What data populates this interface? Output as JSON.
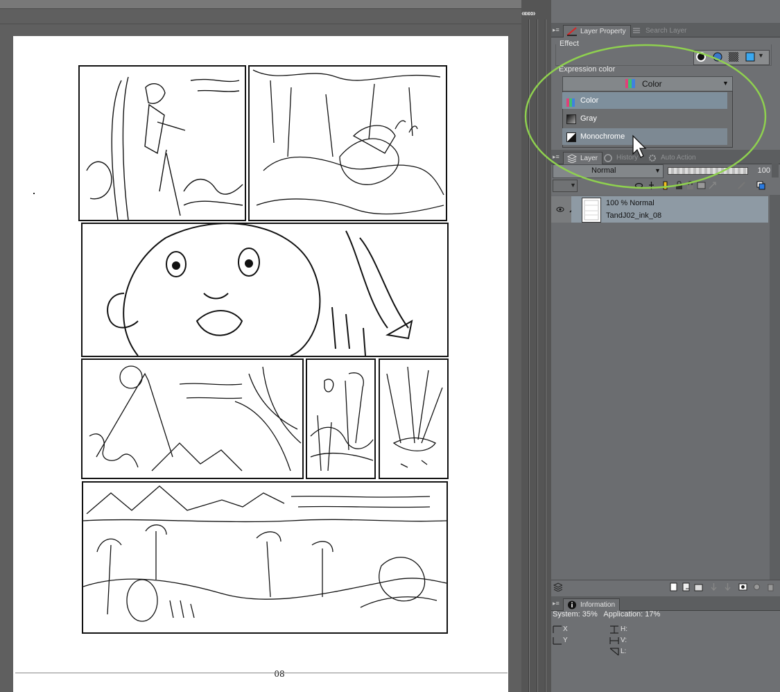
{
  "canvas": {
    "page_number": "08"
  },
  "dock": {
    "collapse_arrows": "«««»"
  },
  "layer_property_panel": {
    "tabs": [
      {
        "label": "Layer Property",
        "active": true,
        "icon": "layer-property-icon"
      },
      {
        "label": "Search Layer",
        "active": false,
        "icon": "search-layer-icon"
      }
    ],
    "effect_label": "Effect",
    "expression_color_label": "Expression color",
    "expression_color_selected": "Color",
    "dropdown_options": [
      {
        "label": "Color",
        "icon": "color-mode-icon",
        "highlighted": true
      },
      {
        "label": "Gray",
        "icon": "gray-mode-icon",
        "highlighted": false
      },
      {
        "label": "Monochrome",
        "icon": "monochrome-mode-icon",
        "highlighted": true
      }
    ],
    "highlight_circle_color": "#8fd14f"
  },
  "layer_panel": {
    "tabs": [
      {
        "label": "Layer",
        "active": true,
        "icon": "layer-icon"
      },
      {
        "label": "History",
        "active": false,
        "icon": "history-icon"
      },
      {
        "label": "Auto Action",
        "active": false,
        "icon": "auto-action-icon"
      }
    ],
    "blend_mode": "Normal",
    "opacity_value": "100",
    "layers": [
      {
        "opacity_mode": "100 %  Normal",
        "name": "TandJ02_ink_08",
        "visible": true
      }
    ]
  },
  "info_panel": {
    "tab_label": "Information",
    "memory_text": "System: 35%   Application: 17%",
    "labels": {
      "x": "X",
      "y": "Y",
      "h": "H:",
      "v": "V:",
      "l": "L:"
    }
  },
  "colors": {
    "selection_blue": "#8e9aa4",
    "panel_bg": "#6e7073",
    "accent_green": "#8fd14f"
  }
}
